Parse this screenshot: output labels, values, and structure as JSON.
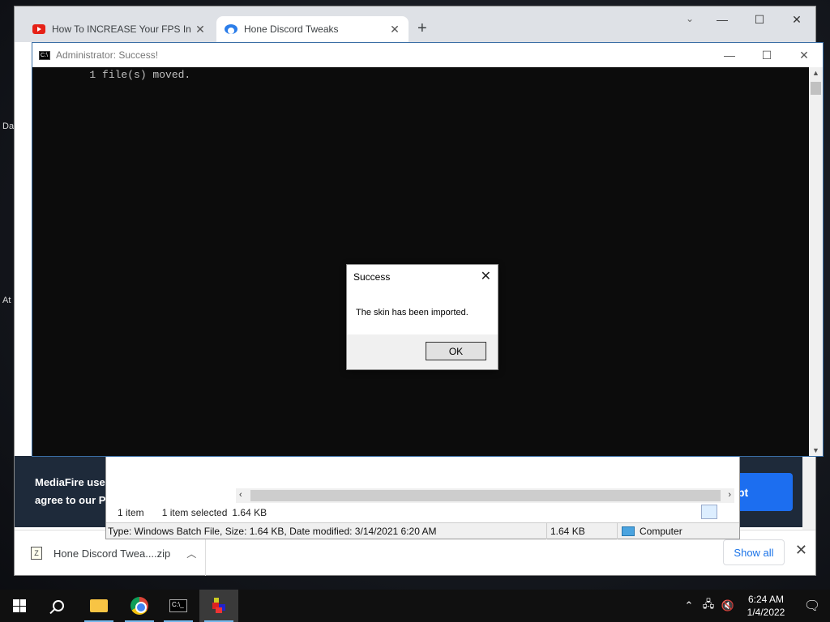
{
  "desktop": {
    "left_labels": [
      "Da",
      "At"
    ]
  },
  "browser": {
    "tabs": [
      {
        "title": "How To INCREASE Your FPS In Minecraft",
        "icon": "youtube-icon"
      },
      {
        "title": "Hone Discord Tweaks",
        "icon": "hone-icon"
      }
    ],
    "new_tab_glyph": "+",
    "banner": {
      "line1": "MediaFire uses",
      "line2": "agree to our Pr",
      "accept_label": "pt",
      "bg_color": "#1e2a3a",
      "accent_color": "#1c6ef0"
    },
    "downloads": {
      "file_name": "Hone Discord Twea....zip",
      "show_all": "Show all"
    }
  },
  "explorer": {
    "item_count": "1 item",
    "selected": "1 item selected",
    "selected_size": "1.64 KB",
    "details": "Type: Windows Batch File, Size: 1.64 KB, Date modified: 3/14/2021 6:20 AM",
    "size": "1.64 KB",
    "location": "Computer"
  },
  "cmd": {
    "title": "Administrator:  Success!",
    "output": "        1 file(s) moved."
  },
  "dialog": {
    "title": "Success",
    "message": "The skin has been imported.",
    "ok_label": "OK"
  },
  "taskbar": {
    "apps": [
      "start-icon",
      "search-icon",
      "file-explorer-icon",
      "chrome-icon",
      "terminal-icon",
      "minecraft-icon"
    ],
    "time": "6:24 AM",
    "date": "1/4/2022"
  }
}
